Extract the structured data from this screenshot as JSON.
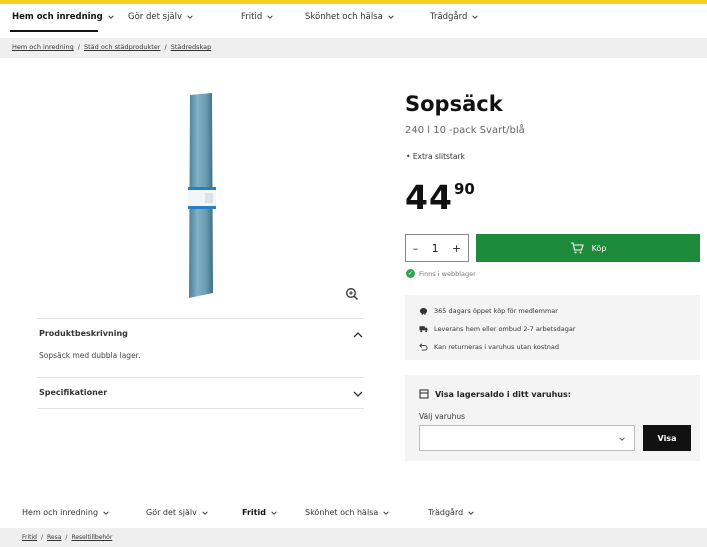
{
  "colors": {
    "accent_yellow": "#f5cf1e",
    "buy_green": "#1d8b3a",
    "stock_green": "#2ea44f"
  },
  "nav": [
    {
      "label": "Hem och inredning",
      "bold": true
    },
    {
      "label": "Gör det själv",
      "bold": false
    },
    {
      "label": "Fritid",
      "bold": false
    },
    {
      "label": "Skönhet och hälsa",
      "bold": false
    },
    {
      "label": "Trädgård",
      "bold": false
    }
  ],
  "breadcrumbs": [
    "Hem och inredning",
    "Städ och städprodukter",
    "Städredskap"
  ],
  "breadcrumb_separator": "/",
  "product": {
    "title": "Sopsäck",
    "subtitle": "240 l 10 -pack Svart/blå",
    "bullet": "Extra slitstark",
    "price_main": "44",
    "price_decimals": "90",
    "quantity": "1",
    "qty_minus": "–",
    "qty_plus": "+",
    "buy_label": "Köp",
    "stock_text": "Finns i webblager"
  },
  "accordion": [
    {
      "title": "Produktbeskrivning",
      "body": "Sopsäck med dubbla lager.",
      "expanded": true
    },
    {
      "title": "Specifikationer",
      "body": "",
      "expanded": false
    }
  ],
  "perks": [
    {
      "icon": "piggy-bank-icon",
      "text": "365 dagars öppet köp för medlemmar"
    },
    {
      "icon": "truck-icon",
      "text": "Leverans hem eller ombud 2-7 arbetsdagar"
    },
    {
      "icon": "return-arrow-icon",
      "text": "Kan returneras i varuhus utan kostnad"
    }
  ],
  "store": {
    "heading": "Visa lagersaldo i ditt varuhus:",
    "select_label": "Välj varuhus",
    "selected_value": "",
    "button_label": "Visa"
  },
  "nav_second": [
    {
      "label": "Hem och inredning",
      "bold": false
    },
    {
      "label": "Gör det själv",
      "bold": false
    },
    {
      "label": "Fritid",
      "bold": true
    },
    {
      "label": "Skönhet och hälsa",
      "bold": false
    },
    {
      "label": "Trädgård",
      "bold": false
    }
  ],
  "breadcrumbs_second": [
    "Fritid",
    "Resa",
    "Reseltillbehör"
  ]
}
